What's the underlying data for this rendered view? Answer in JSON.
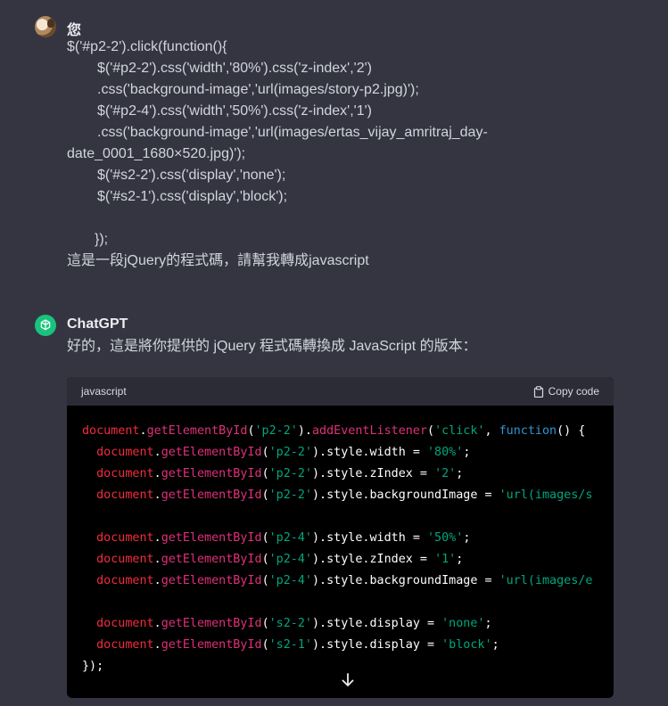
{
  "user": {
    "name": "您",
    "message_lines": [
      {
        "text": "$('#p2-2').click(function(){",
        "indent": 0
      },
      {
        "text": "$('#p2-2').css('width','80%').css('z-index','2')",
        "indent": 1
      },
      {
        "text": ".css('background-image','url(images/story-p2.jpg)');",
        "indent": 1
      },
      {
        "text": "$('#p2-4').css('width','50%').css('z-index','1')",
        "indent": 1
      },
      {
        "text": ".css('background-image','url(images/ertas_vijay_amritraj_day-",
        "indent": 1
      },
      {
        "text": "date_0001_1680×520.jpg)');",
        "indent": 0
      },
      {
        "text": "$('#s2-2').css('display','none');",
        "indent": 1
      },
      {
        "text": "$('#s2-1').css('display','block');",
        "indent": 1
      },
      {
        "text": "",
        "indent": 0
      },
      {
        "text": "});",
        "indent": 2
      },
      {
        "text": "這是一段jQuery的程式碼，請幫我轉成javascript",
        "indent": 0
      }
    ]
  },
  "assistant": {
    "name": "ChatGPT",
    "reply": "好的，這是將你提供的 jQuery 程式碼轉換成 JavaScript 的版本：",
    "code": {
      "language": "javascript",
      "copy_label": "Copy code",
      "lines": [
        [
          [
            "obj",
            "document"
          ],
          [
            "plain",
            "."
          ],
          [
            "fn",
            "getElementById"
          ],
          [
            "plain",
            "("
          ],
          [
            "str",
            "'p2-2'"
          ],
          [
            "plain",
            ")."
          ],
          [
            "fn",
            "addEventListener"
          ],
          [
            "plain",
            "("
          ],
          [
            "str",
            "'click'"
          ],
          [
            "plain",
            ", "
          ],
          [
            "kw",
            "function"
          ],
          [
            "plain",
            "() {"
          ]
        ],
        [
          [
            "plain",
            "  "
          ],
          [
            "obj",
            "document"
          ],
          [
            "plain",
            "."
          ],
          [
            "fn",
            "getElementById"
          ],
          [
            "plain",
            "("
          ],
          [
            "str",
            "'p2-2'"
          ],
          [
            "plain",
            ").style.width = "
          ],
          [
            "str",
            "'80%'"
          ],
          [
            "plain",
            ";"
          ]
        ],
        [
          [
            "plain",
            "  "
          ],
          [
            "obj",
            "document"
          ],
          [
            "plain",
            "."
          ],
          [
            "fn",
            "getElementById"
          ],
          [
            "plain",
            "("
          ],
          [
            "str",
            "'p2-2'"
          ],
          [
            "plain",
            ").style.zIndex = "
          ],
          [
            "str",
            "'2'"
          ],
          [
            "plain",
            ";"
          ]
        ],
        [
          [
            "plain",
            "  "
          ],
          [
            "obj",
            "document"
          ],
          [
            "plain",
            "."
          ],
          [
            "fn",
            "getElementById"
          ],
          [
            "plain",
            "("
          ],
          [
            "str",
            "'p2-2'"
          ],
          [
            "plain",
            ").style.backgroundImage = "
          ],
          [
            "str",
            "'url(images/s"
          ]
        ],
        [],
        [
          [
            "plain",
            "  "
          ],
          [
            "obj",
            "document"
          ],
          [
            "plain",
            "."
          ],
          [
            "fn",
            "getElementById"
          ],
          [
            "plain",
            "("
          ],
          [
            "str",
            "'p2-4'"
          ],
          [
            "plain",
            ").style.width = "
          ],
          [
            "str",
            "'50%'"
          ],
          [
            "plain",
            ";"
          ]
        ],
        [
          [
            "plain",
            "  "
          ],
          [
            "obj",
            "document"
          ],
          [
            "plain",
            "."
          ],
          [
            "fn",
            "getElementById"
          ],
          [
            "plain",
            "("
          ],
          [
            "str",
            "'p2-4'"
          ],
          [
            "plain",
            ").style.zIndex = "
          ],
          [
            "str",
            "'1'"
          ],
          [
            "plain",
            ";"
          ]
        ],
        [
          [
            "plain",
            "  "
          ],
          [
            "obj",
            "document"
          ],
          [
            "plain",
            "."
          ],
          [
            "fn",
            "getElementById"
          ],
          [
            "plain",
            "("
          ],
          [
            "str",
            "'p2-4'"
          ],
          [
            "plain",
            ").style.backgroundImage = "
          ],
          [
            "str",
            "'url(images/e"
          ]
        ],
        [],
        [
          [
            "plain",
            "  "
          ],
          [
            "obj",
            "document"
          ],
          [
            "plain",
            "."
          ],
          [
            "fn",
            "getElementById"
          ],
          [
            "plain",
            "("
          ],
          [
            "str",
            "'s2-2'"
          ],
          [
            "plain",
            ").style.display = "
          ],
          [
            "str",
            "'none'"
          ],
          [
            "plain",
            ";"
          ]
        ],
        [
          [
            "plain",
            "  "
          ],
          [
            "obj",
            "document"
          ],
          [
            "plain",
            "."
          ],
          [
            "fn",
            "getElementById"
          ],
          [
            "plain",
            "("
          ],
          [
            "str",
            "'s2-1'"
          ],
          [
            "plain",
            ").style.display = "
          ],
          [
            "str",
            "'block'"
          ],
          [
            "plain",
            ";"
          ]
        ],
        [
          [
            "plain",
            "});"
          ]
        ]
      ]
    }
  },
  "icons": {
    "copy": "clipboard-icon",
    "scroll": "arrow-down-icon"
  }
}
